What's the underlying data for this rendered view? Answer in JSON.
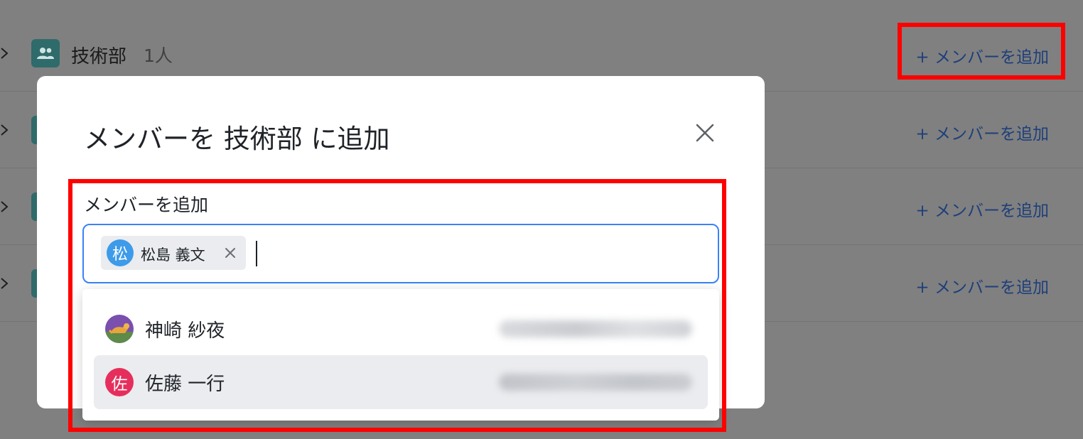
{
  "background_list": {
    "rows": [
      {
        "group_name": "技術部",
        "member_count": "1人",
        "add_label": "+ メンバーを追加"
      },
      {
        "group_name": "",
        "member_count": "",
        "add_label": "+ メンバーを追加"
      },
      {
        "group_name": "",
        "member_count": "",
        "add_label": "+ メンバーを追加"
      },
      {
        "group_name": "",
        "member_count": "",
        "add_label": "+ メンバーを追加"
      }
    ]
  },
  "modal": {
    "title": "メンバーを 技術部 に追加",
    "close_icon": "close-icon",
    "field_label": "メンバーを追加",
    "selected_members": [
      {
        "avatar_text": "松",
        "name": "松島 義文",
        "avatar_color": "#3d9be9"
      }
    ],
    "suggestions": [
      {
        "name": "神崎 紗夜",
        "avatar_icon": "dog-photo-avatar",
        "highlighted": false
      },
      {
        "name": "佐藤 一行",
        "avatar_text": "佐",
        "avatar_color": "#e62e5c",
        "highlighted": true
      }
    ]
  },
  "colors": {
    "accent_blue": "#3b82f6",
    "link_blue": "#1e3f7a",
    "group_icon_teal": "#2f6b6b",
    "annotation_red": "#ff0000"
  }
}
